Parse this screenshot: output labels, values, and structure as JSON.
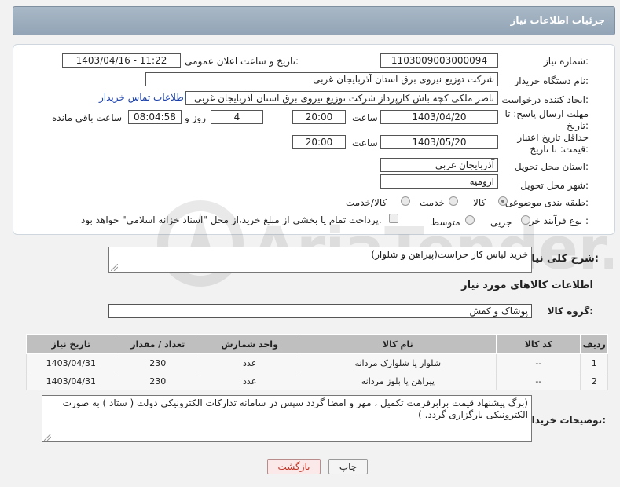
{
  "header": {
    "title": "جزئیات اطلاعات نیاز"
  },
  "form": {
    "need_number_label": "شماره نیاز:",
    "need_number": "1103009003000094",
    "announce_label": "تاریخ و ساعت اعلان عمومی:",
    "announce_value": "1403/04/16 - 11:22",
    "buyer_org_label": "نام دستگاه خریدار:",
    "buyer_org": "شرکت توزیع نیروی برق استان آذربایجان غربی",
    "requester_label": "ایجاد کننده درخواست:",
    "requester": "ناصر ملکی کچه باش کارپرداز شرکت توزیع نیروی برق استان آذربایجان غربی",
    "contact_link": "اطلاعات تماس خریدار",
    "reply_deadline_label": "مهلت ارسال پاسخ: تا تاریخ:",
    "reply_date": "1403/04/20",
    "time_label": "ساعت",
    "reply_time": "20:00",
    "days_value": "4",
    "days_label": "روز و",
    "remaining_time": "08:04:58",
    "remaining_label": "ساعت باقی مانده",
    "price_validity_label": "حداقل تاریخ اعتبار قیمت: تا تاریخ:",
    "price_date": "1403/05/20",
    "price_time": "20:00",
    "province_label": "استان محل تحویل:",
    "province": "آذربایجان غربی",
    "city_label": "شهر محل تحویل:",
    "city": "ارومیه",
    "category_label": "طبقه بندی موضوعی:",
    "category_options": [
      "کالا",
      "خدمت",
      "کالا/خدمت"
    ],
    "process_label": "نوع فرآیند خرید :",
    "process_options": [
      "جزیی",
      "متوسط"
    ],
    "payment_note": "پرداخت تمام یا بخشی از مبلغ خرید،از محل \"اسناد خزانه اسلامی\" خواهد بود."
  },
  "description": {
    "label": "شرح کلی نیاز:",
    "value": "خرید لباس کار حراست(پیراهن و شلوار)"
  },
  "goods_section_title": "اطلاعات کالاهای مورد نیاز",
  "goods_group": {
    "label": "گروه کالا:",
    "value": "پوشاک و کفش"
  },
  "table": {
    "headers": [
      "ردیف",
      "کد کالا",
      "نام کالا",
      "واحد شمارش",
      "تعداد / مقدار",
      "تاریخ نیاز"
    ],
    "rows": [
      [
        "1",
        "--",
        "شلوار یا شلوارک مردانه",
        "عدد",
        "230",
        "1403/04/31"
      ],
      [
        "2",
        "--",
        "پیراهن یا بلوز مردانه",
        "عدد",
        "230",
        "1403/04/31"
      ]
    ]
  },
  "buyer_notes": {
    "label": "توضیحات خریدار:",
    "value": "(برگ پیشنهاد قیمت برابرفرمت تکمیل ، مهر و امضا گردد سپس در سامانه تدارکات الکترونیکی دولت ( ستاد ) به صورت الکترونیکی  بارگزاری گردد. )"
  },
  "buttons": {
    "print": "چاپ",
    "back": "بازگشت"
  },
  "watermark_text": "AriaTender.neT"
}
